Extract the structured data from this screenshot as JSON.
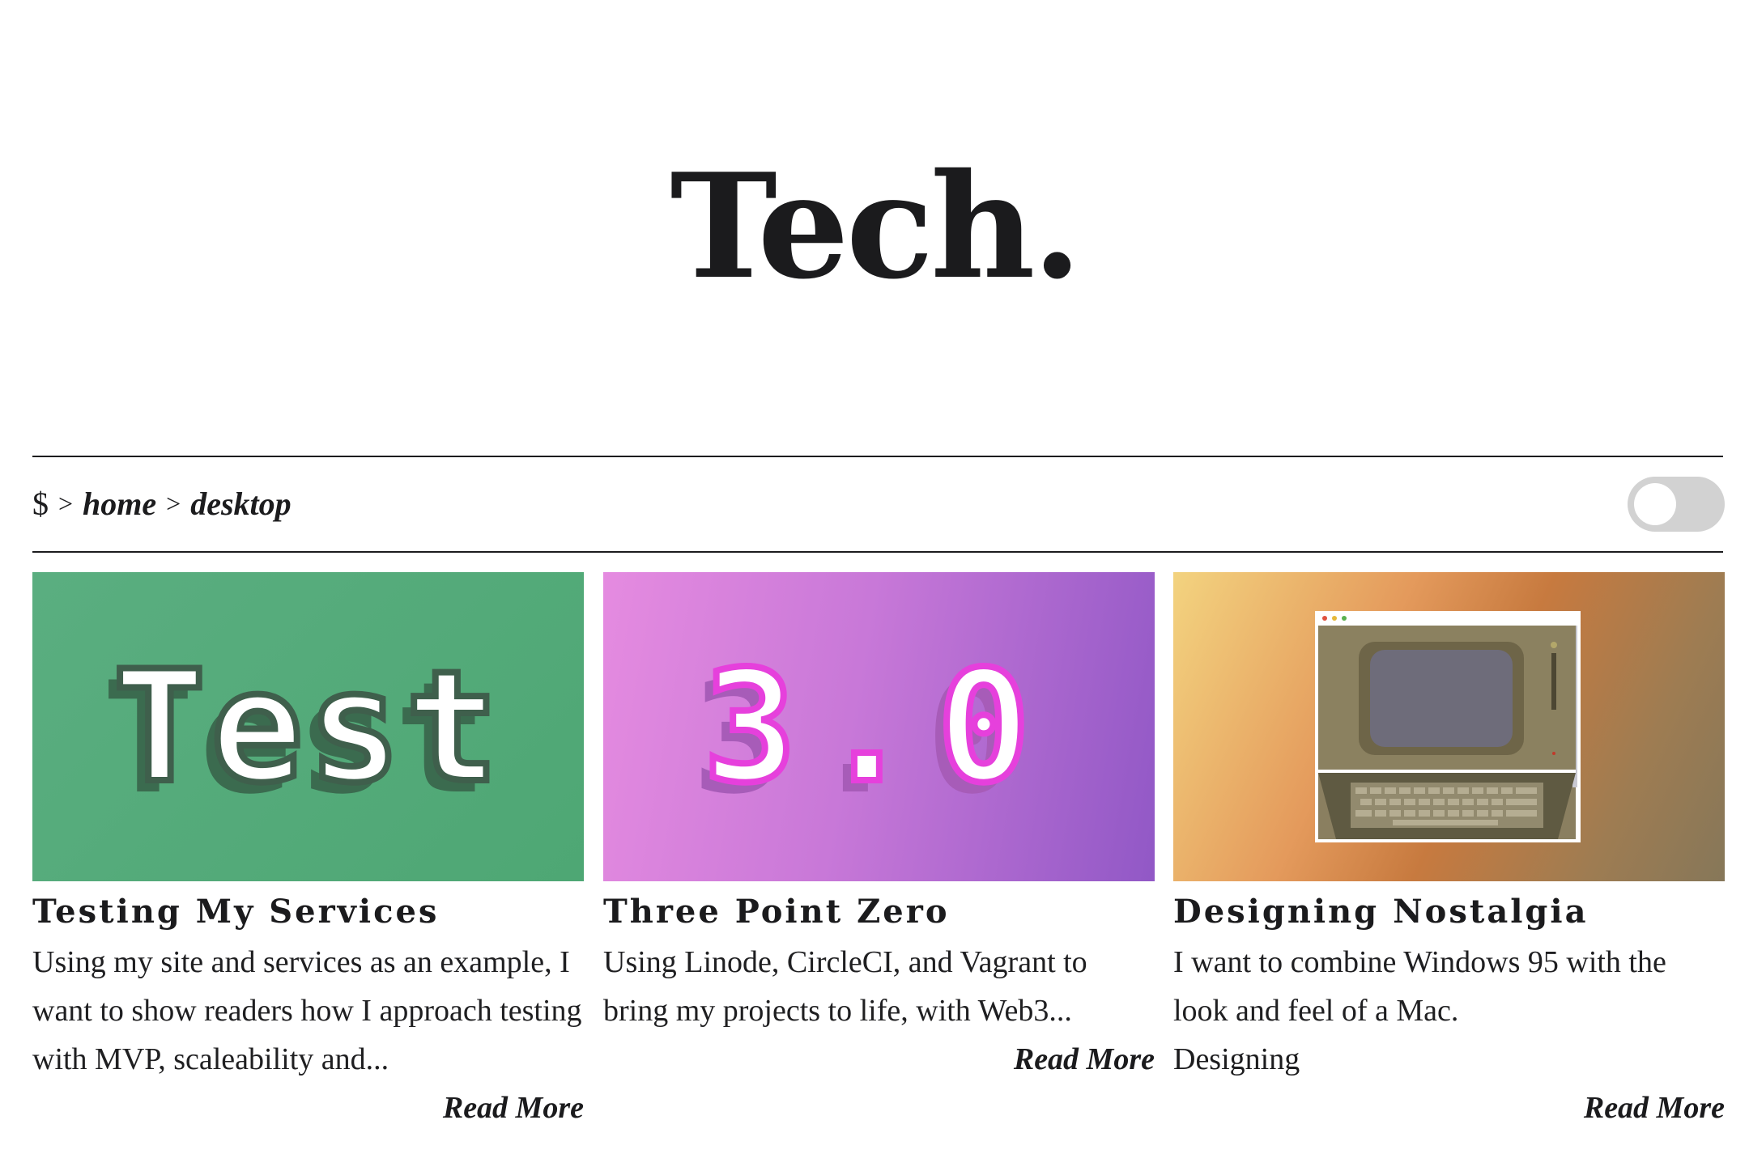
{
  "site": {
    "title": "Tech."
  },
  "breadcrumb": {
    "prompt": "$",
    "sep1": ">",
    "crumb1": "home",
    "sep2": ">",
    "crumb2": "desktop"
  },
  "theme_toggle": {
    "state": "off"
  },
  "posts": [
    {
      "thumb_text": "Test",
      "title": "Testing My Services",
      "excerpt": "Using my site and services as an example, I want to show readers how I approach testing with MVP, scaleability and...",
      "read_more": "Read More"
    },
    {
      "thumb_text": "3.0",
      "title": "Three Point Zero",
      "excerpt": "Using Linode, CircleCI, and Vagrant to bring my projects to life, with Web3...",
      "read_more": "Read More"
    },
    {
      "thumb_icon": "retro-computer-icon",
      "title": "Designing Nostalgia",
      "excerpt": "I want to combine Windows 95 with the look and feel of a Mac.",
      "tag": "Designing",
      "read_more": "Read More"
    }
  ],
  "colors": {
    "text": "#1c1c1e",
    "green_thumb": "#52aa78",
    "purple_accent": "#e640dc",
    "toggle_track": "#d2d2d2"
  }
}
